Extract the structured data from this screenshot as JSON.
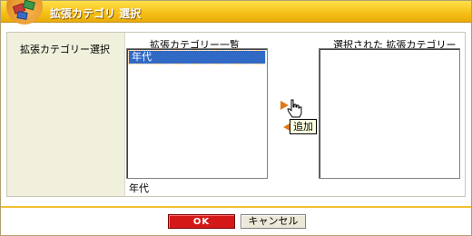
{
  "window": {
    "title": "拡張カテゴリ 選択"
  },
  "panel": {
    "label": "拡張カテゴリー選択",
    "available_title": "拡張カテゴリー一覧",
    "selected_title": "選択された 拡張カテゴリー",
    "available_items": [
      {
        "label": "年代",
        "selected": true
      }
    ],
    "selected_items": [],
    "available_caption": "年代"
  },
  "controls": {
    "add_tooltip": "追加"
  },
  "buttons": {
    "ok": "OK",
    "cancel": "キャンセル"
  },
  "colors": {
    "title_bar": "#f6c21a",
    "ok_button": "#d41818",
    "list_highlight": "#316ac5",
    "arrow": "#e07818"
  }
}
